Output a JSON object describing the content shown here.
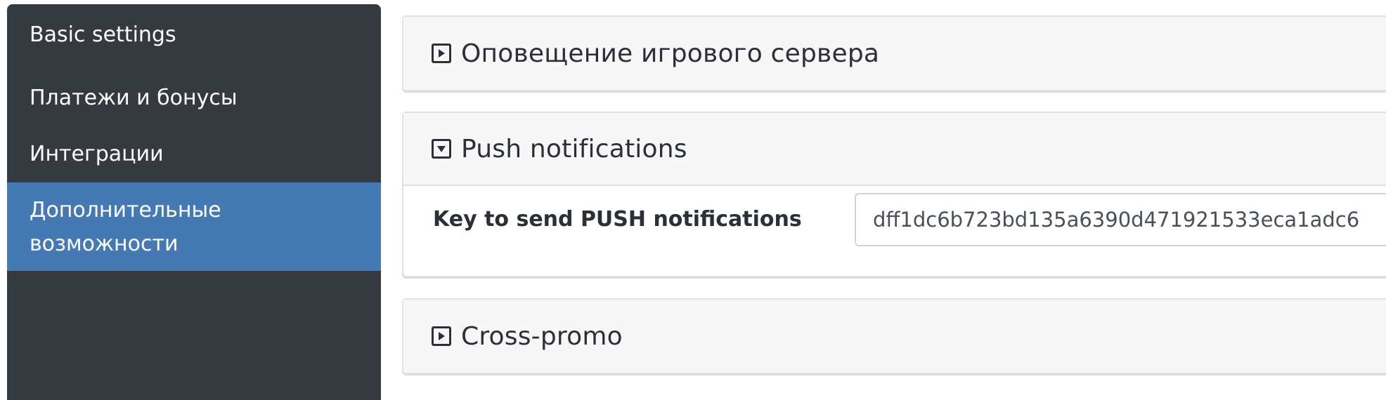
{
  "sidebar": {
    "items": [
      {
        "label": "Basic settings",
        "active": false
      },
      {
        "label": "Платежи и бонусы",
        "active": false
      },
      {
        "label": "Интеграции",
        "active": false
      },
      {
        "label": "Дополнительные возможности",
        "active": true
      }
    ]
  },
  "panels": [
    {
      "title": "Оповещение игрового сервера",
      "icon": "expand-icon",
      "open": false
    },
    {
      "title": "Push notifications",
      "icon": "collapse-icon",
      "open": true,
      "field": {
        "label": "Key to send PUSH notifications",
        "value": "dff1dc6b723bd135a6390d471921533eca1adc6"
      }
    },
    {
      "title": "Cross-promo",
      "icon": "expand-icon",
      "open": false
    }
  ],
  "colors": {
    "sidebar_bg": "#343a40",
    "active_item": "#4479b4",
    "panel_header": "#f7f7f7"
  }
}
